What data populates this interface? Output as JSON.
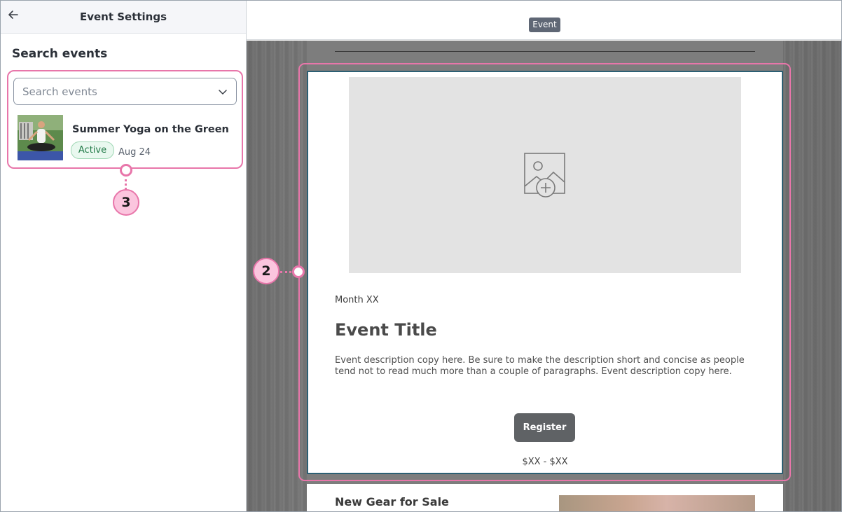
{
  "left_panel": {
    "title": "Event Settings",
    "search_heading": "Search events",
    "search_placeholder": "Search events",
    "event": {
      "name": "Summer Yoga on the Green",
      "status": "Active",
      "date": "Aug 24"
    }
  },
  "annotations": {
    "marker_left": "3",
    "marker_right": "2"
  },
  "editor": {
    "tag": "Event",
    "block": {
      "month": "Month XX",
      "title": "Event Title",
      "description": "Event description copy here. Be sure to make the description short and concise as people tend not to read much more than a couple of paragraphs. Event description copy here.",
      "register_label": "Register",
      "price": "$XX - $XX"
    },
    "next_section_title": "New Gear for Sale"
  },
  "colors": {
    "callout": "#e876aa",
    "block_border": "#2c5f73",
    "button": "#5f6265",
    "badge_green": "#227a48"
  }
}
